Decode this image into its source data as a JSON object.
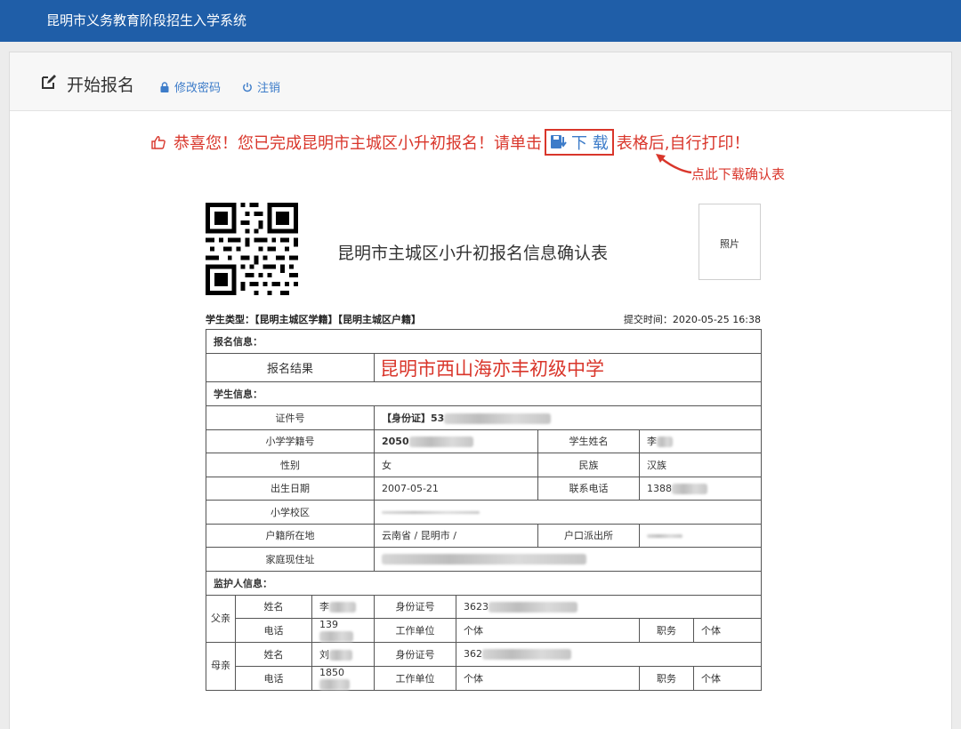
{
  "header": {
    "title": "昆明市义务教育阶段招生入学系统"
  },
  "toolbar": {
    "title": "开始报名",
    "change_password": "修改密码",
    "logout": "注销"
  },
  "notice": {
    "before": "恭喜您！您已完成昆明市主城区小升初报名！请单击",
    "download": "下 载",
    "after": "表格后,自行打印！",
    "hint": "点此下载确认表"
  },
  "form": {
    "title": "昆明市主城区小升初报名信息确认表",
    "photo": "照片",
    "student_type": "学生类型：【昆明主城区学籍】【昆明主城区户籍】",
    "submit_time": "提交时间：2020-05-25 16:38",
    "sections": {
      "enroll": "报名信息：",
      "student": "学生信息：",
      "guardian": "监护人信息："
    },
    "enroll_result_label": "报名结果",
    "enroll_result_value": "昆明市西山海亦丰初级中学",
    "labels": {
      "id_no": "证件号",
      "student_no": "小学学籍号",
      "name": "学生姓名",
      "gender": "性别",
      "ethnicity": "民族",
      "birth": "出生日期",
      "phone": "联系电话",
      "school": "小学校区",
      "hukou": "户籍所在地",
      "police": "户口派出所",
      "address": "家庭现住址"
    },
    "values": {
      "id_no": "【身份证】53",
      "student_no": "2050",
      "name": "李",
      "gender": "女",
      "ethnicity": "汉族",
      "birth": "2007-05-21",
      "phone": "1388",
      "hukou": "云南省 / 昆明市 /"
    },
    "guardian": {
      "father_label": "父亲",
      "mother_label": "母亲",
      "name_label": "姓名",
      "id_label": "身份证号",
      "phone_label": "电话",
      "work_label": "工作单位",
      "job_label": "职务",
      "father": {
        "name": "李",
        "id": "3623",
        "phone": "139",
        "work": "个体",
        "job": "个体"
      },
      "mother": {
        "name": "刘",
        "id": "362",
        "phone": "1850",
        "work": "个体",
        "job": "个体"
      }
    }
  }
}
